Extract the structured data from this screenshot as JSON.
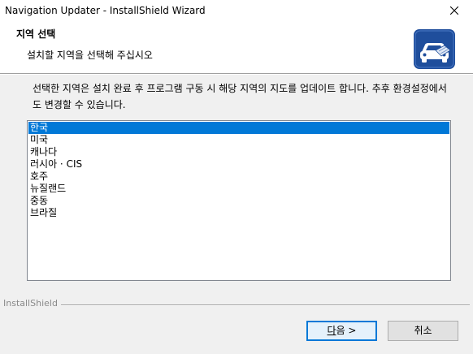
{
  "window": {
    "title": "Navigation Updater - InstallShield Wizard"
  },
  "header": {
    "title": "지역 선택",
    "subtitle": "설치할 지역을 선택해 주십시오",
    "icon": "car-with-map-icon"
  },
  "description": "선택한 지역은 설치 완료 후 프로그램 구동 시 해당 지역의 지도를 업데이트 합니다. 추후 환경설정에서도 변경할 수 있습니다.",
  "regions": {
    "selected_index": 0,
    "items": [
      "한국",
      "미국",
      "캐나다",
      "러시아 · CIS",
      "호주",
      "뉴질랜드",
      "중동",
      "브라질"
    ]
  },
  "footer": {
    "brand": "InstallShield",
    "next_mnemonic": "다",
    "next_rest": "음 >",
    "cancel_label": "취소"
  },
  "colors": {
    "selection": "#0078d7",
    "icon_bg": "#1f4e9c"
  }
}
